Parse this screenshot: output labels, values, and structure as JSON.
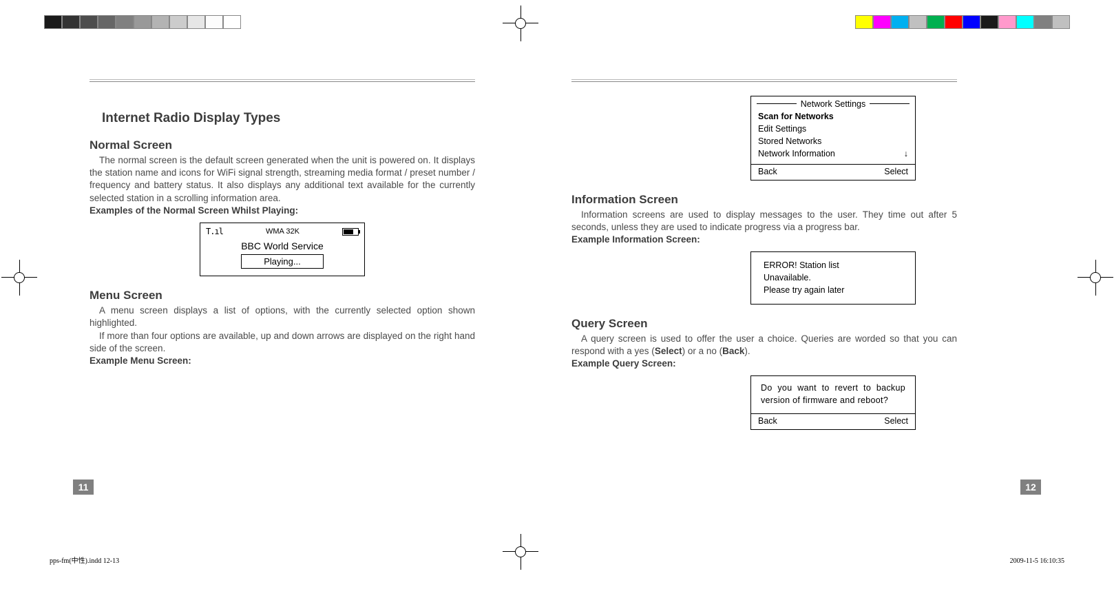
{
  "colorbar_left": [
    "#1a1a1a",
    "#333333",
    "#4d4d4d",
    "#666666",
    "#808080",
    "#999999",
    "#b3b3b3",
    "#cccccc",
    "#e6e6e6",
    "#fcfcfc",
    "#ffffff"
  ],
  "colorbar_right": [
    "#ffff00",
    "#ff00ff",
    "#00b0f0",
    "#c0c0c0",
    "#00b050",
    "#ff0000",
    "#0000ff",
    "#1a1a1a",
    "#ff99cc",
    "#00ffff",
    "#808080",
    "#c0c0c0"
  ],
  "left": {
    "title": "Internet Radio Display Types",
    "sections": {
      "normal": {
        "heading": "Normal Screen",
        "p1": "The normal screen is the default screen generated when the unit is powered on. It displays the station name and icons for WiFi signal strength, streaming media format / preset number / frequency and battery status. It also displays any additional text available for the currently selected station in a scrolling information area.",
        "example_label": "Examples of the Normal Screen Whilst Playing:",
        "screen": {
          "codec": "WMA 32K",
          "station": "BBC World Service",
          "status": "Playing..."
        }
      },
      "menu": {
        "heading": "Menu Screen",
        "p1": "A menu screen displays a list of options, with the currently selected option shown highlighted.",
        "p2": "If more than four options are available, up and down arrows are displayed on the right hand side of the screen.",
        "example_label": "Example Menu Screen:"
      }
    },
    "page_num": "11"
  },
  "right": {
    "menu_screen": {
      "title": "Network Settings",
      "items": [
        "Scan for Networks",
        "Edit Settings",
        "Stored Networks",
        "Network Information"
      ],
      "arrow": "↓",
      "back": "Back",
      "select": "Select"
    },
    "info": {
      "heading": "Information Screen",
      "p1": "Information screens are used to display messages to the user. They time out after 5 seconds, unless they are used to indicate progress via a progress bar.",
      "example_label": "Example Information Screen:",
      "lines": [
        "ERROR! Station list",
        "Unavailable.",
        "Please try again later"
      ]
    },
    "query": {
      "heading": "Query Screen",
      "p1a": "A query screen is used to offer the user a choice. Queries are worded so that you can respond with a yes (",
      "sel": "Select",
      "p1b": ") or a no (",
      "bk": "Back",
      "p1c": ").",
      "example_label": "Example Query Screen:",
      "body": "Do you want to revert to backup version of firmware and reboot?",
      "back": "Back",
      "select": "Select"
    },
    "page_num": "12"
  },
  "footer": {
    "file": "pps-fm(中性).indd   12-13",
    "date": "2009-11-5   16:10:35"
  }
}
